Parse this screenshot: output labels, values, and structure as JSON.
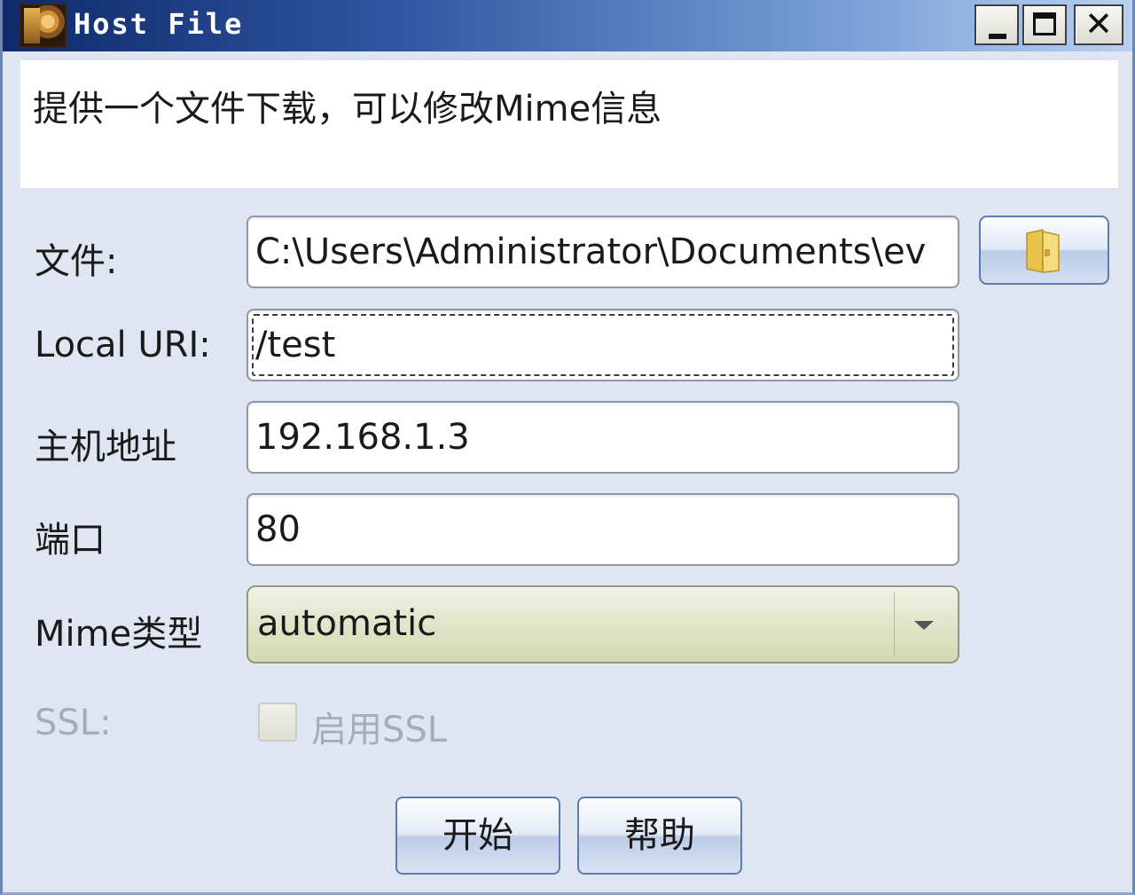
{
  "window": {
    "title": "Host File",
    "icon": "app-icon"
  },
  "description": "提供一个文件下载，可以修改Mime信息",
  "form": {
    "file": {
      "label": "文件:",
      "value": "C:\\Users\\Administrator\\Documents\\ev",
      "browse_icon": "folder-icon"
    },
    "local_uri": {
      "label": "Local URI:",
      "value": "/test"
    },
    "host": {
      "label": "主机地址",
      "value": "192.168.1.3"
    },
    "port": {
      "label": "端口",
      "value": "80"
    },
    "mime": {
      "label": "Mime类型",
      "value": "automatic"
    },
    "ssl": {
      "label": "SSL:",
      "checkbox_label": "启用SSL",
      "checked": false,
      "enabled": false
    }
  },
  "buttons": {
    "start": "开始",
    "help": "帮助"
  }
}
